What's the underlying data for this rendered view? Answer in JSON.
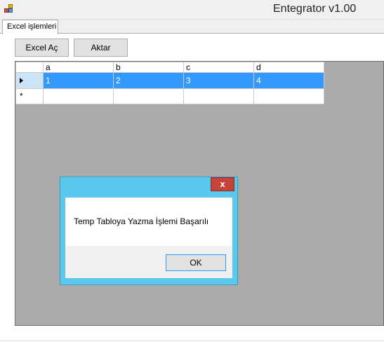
{
  "window": {
    "title": "Entegrator v1.00"
  },
  "tabs": [
    {
      "label": "Excel işlemleri",
      "active": true
    }
  ],
  "toolbar": {
    "open_label": "Excel Aç",
    "transfer_label": "Aktar"
  },
  "grid": {
    "columns": [
      "a",
      "b",
      "c",
      "d"
    ],
    "rows": [
      {
        "cells": [
          "1",
          "2",
          "3",
          "4"
        ],
        "selected": true
      }
    ],
    "new_row_marker": "*"
  },
  "dialog": {
    "message": "Temp Tabloya Yazma İşlemi Başarılı",
    "ok_label": "OK",
    "close_label": "x"
  },
  "colors": {
    "selection": "#3399ff",
    "dialog_frame": "#5bc8ee",
    "close_button": "#c7433a"
  }
}
